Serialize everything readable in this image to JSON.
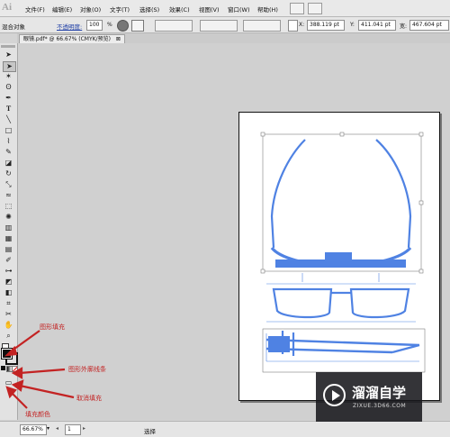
{
  "menubar": {
    "logo": "Ai",
    "items": [
      "文件(F)",
      "编辑(E)",
      "对象(O)",
      "文字(T)",
      "选择(S)",
      "效果(C)",
      "视图(V)",
      "窗口(W)",
      "帮助(H)"
    ]
  },
  "control": {
    "label": "混合对象",
    "opacity_label": "不透明度:",
    "opacity_value": "100",
    "opacity_unit": "%",
    "x_label": "X:",
    "x_value": "388.119 pt",
    "y_label": "Y:",
    "y_value": "411.041 pt",
    "w_label": "宽:",
    "w_value": "467.604 pt"
  },
  "document": {
    "tab_label": "眼镜.pdf* @ 66.67% (CMYK/预览)",
    "close_glyph": "⊠"
  },
  "annotations": {
    "fill": "图形填充",
    "stroke": "图形外廓线条",
    "none": "取消填充",
    "fill_color": "填充颜色"
  },
  "status": {
    "zoom": "66.67%",
    "page": "1",
    "mode": "选择"
  },
  "watermark": {
    "brand": "溜溜自学",
    "url": "ZIXUE.3D66.COM"
  },
  "colors": {
    "accent_blue": "#4f82e3",
    "annotation_red": "#c32323"
  }
}
